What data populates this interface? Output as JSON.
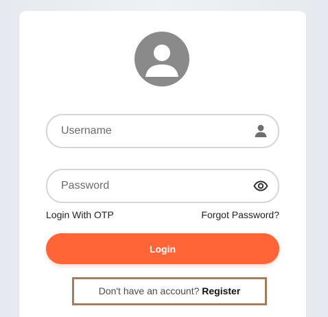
{
  "login_form": {
    "username": {
      "value": "",
      "placeholder": "Username",
      "icon": "user-icon"
    },
    "password": {
      "value": "",
      "placeholder": "Password",
      "icon": "eye-icon"
    },
    "login_with_otp_label": "Login With OTP",
    "forgot_password_label": "Forgot Password?",
    "login_button_label": "Login",
    "register_prompt_text": "Don't have an account?",
    "register_link_label": "Register"
  },
  "avatar": {
    "icon": "profile-avatar-icon"
  },
  "colors": {
    "accent": "#ff6536",
    "avatar_bg": "#8a8a8a",
    "input_border": "#d6d6d6",
    "register_box_border": "#a67c5c"
  }
}
